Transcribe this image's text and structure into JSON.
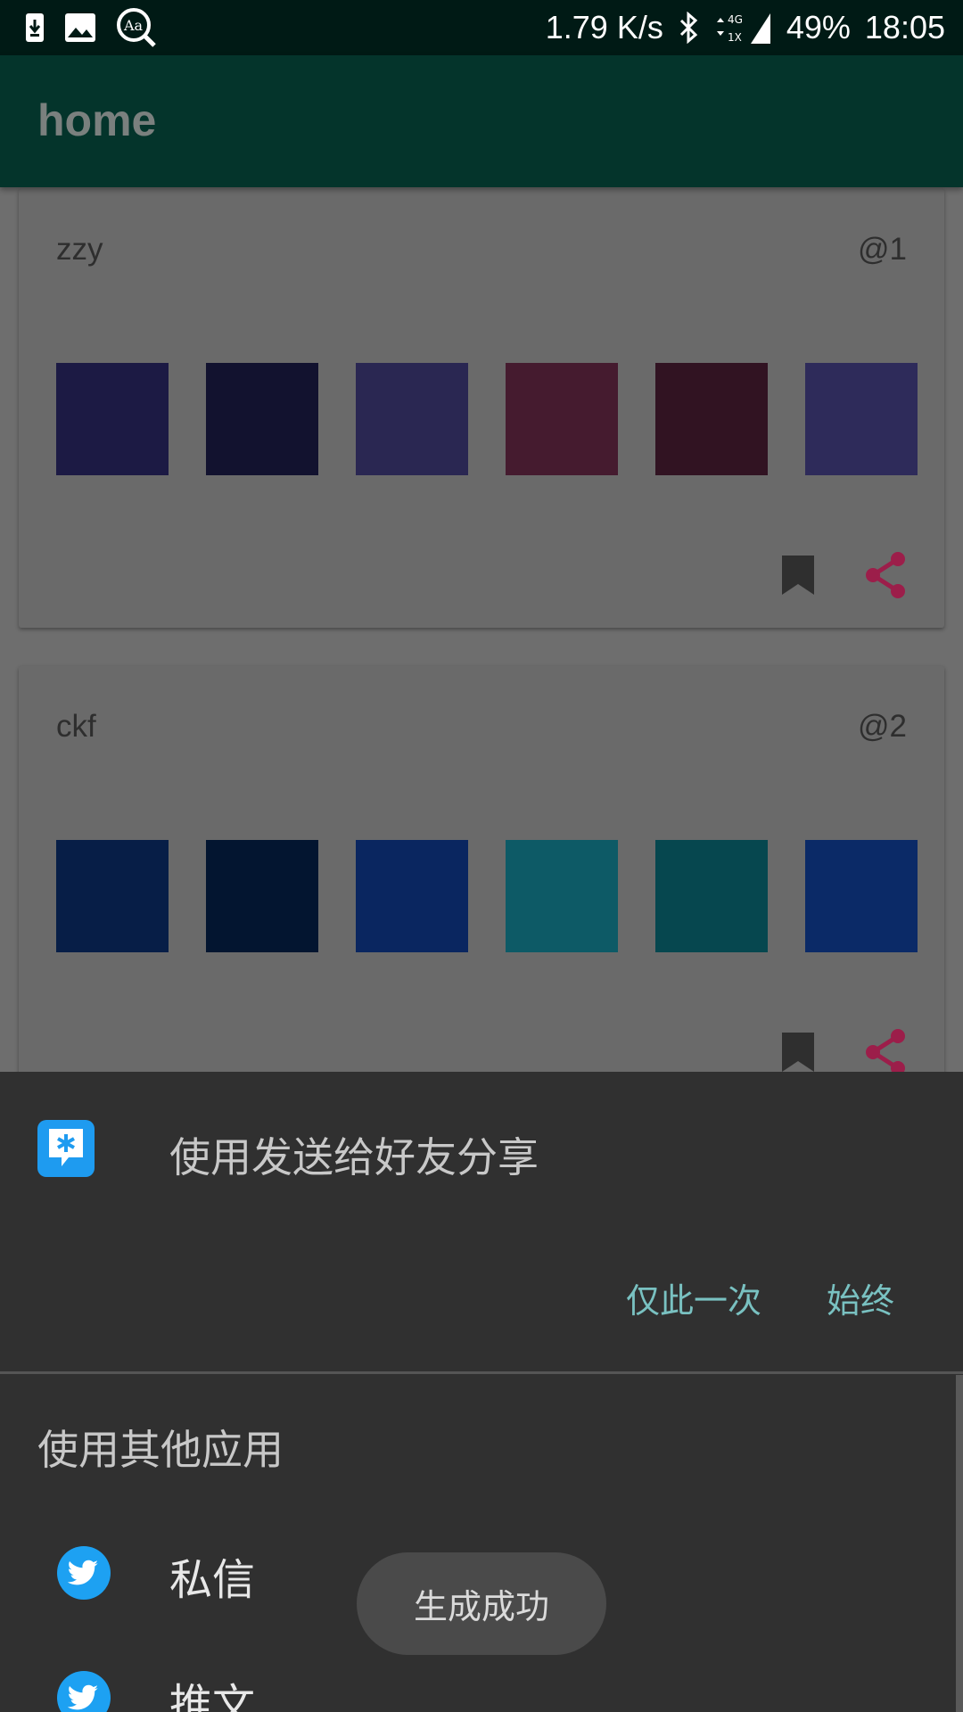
{
  "status_bar": {
    "left_icons": [
      "download-icon",
      "image-icon",
      "font-zoom-icon"
    ],
    "net_speed": "1.79 K/s",
    "network": "4G",
    "sim": "1X",
    "battery": "49%",
    "time": "18:05"
  },
  "app_bar": {
    "title": "home"
  },
  "cards": [
    {
      "user": "zzy",
      "id": "@1",
      "colors": [
        "#1c1a44",
        "#12122f",
        "#2a2752",
        "#451b2f",
        "#311322",
        "#2e2b5a"
      ]
    },
    {
      "user": "ckf",
      "id": "@2",
      "colors": [
        "#071e47",
        "#031530",
        "#0a2660",
        "#0d5a66",
        "#06474f",
        "#0b2a67"
      ]
    }
  ],
  "accent_color": "#d81b60",
  "share_sheet": {
    "preferred_title": "使用发送给好友分享",
    "just_once_label": "仅此一次",
    "always_label": "始终",
    "other_apps_title": "使用其他应用",
    "apps": [
      {
        "label": "私信",
        "icon": "twitter-icon"
      },
      {
        "label": "推文",
        "icon": "twitter-icon"
      }
    ]
  },
  "toast": {
    "message": "生成成功"
  }
}
